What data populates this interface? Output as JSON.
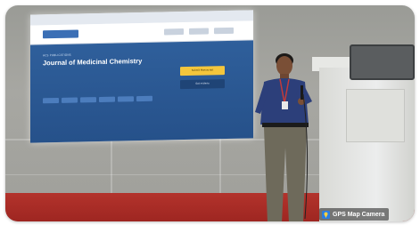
{
  "screen": {
    "small_label": "ACS PUBLICATIONS",
    "journal_title": "Journal of Medicinal Chemistry",
    "description": "",
    "submit_label": "Submit Manuscript",
    "alert_label": "Get e-Alerts"
  },
  "watermark": {
    "label": "GPS Map Camera"
  },
  "colors": {
    "hero_blue": "#2f5f9b",
    "cta_yellow": "#f4c63c",
    "floor_red": "#b3332c",
    "shirt_blue": "#2c3f7a"
  }
}
